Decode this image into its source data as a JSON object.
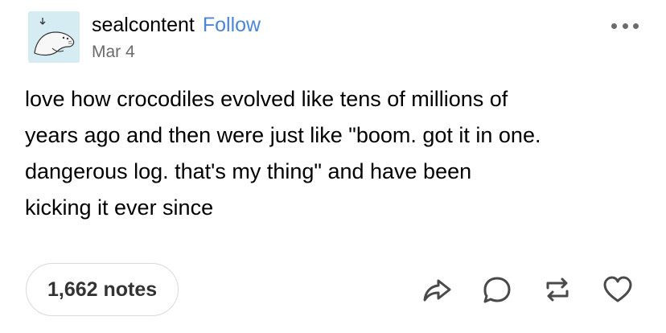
{
  "post": {
    "username": "sealcontent",
    "follow_label": "Follow",
    "date": "Mar 4",
    "text": "love how crocodiles evolved like tens of millions of\nyears ago and then were just like \"boom. got it in one.\ndangerous log. that's my thing\" and have been\nkicking it ever since",
    "notes": "1,662 notes"
  },
  "icons": {
    "avatar": "seal-avatar",
    "more": "more-options-icon",
    "share": "share-icon",
    "reply": "reply-icon",
    "reblog": "reblog-icon",
    "like": "heart-icon"
  },
  "colors": {
    "follow": "#4a86d8",
    "secondary_text": "#6b6b6b",
    "icon": "#4a4a4a",
    "avatar_bg": "#d4ecf2"
  }
}
